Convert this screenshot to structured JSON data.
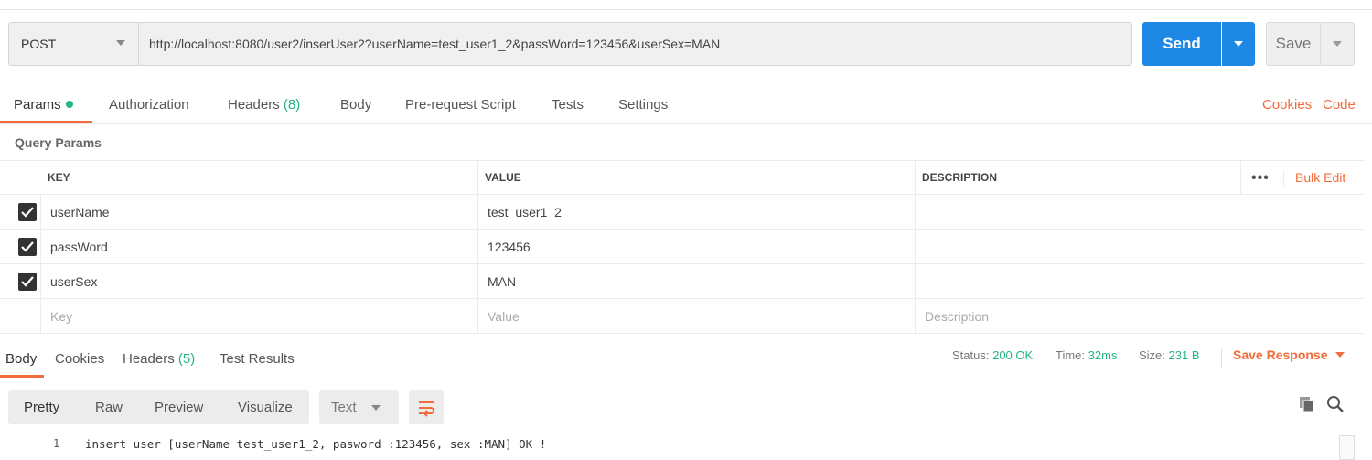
{
  "request": {
    "method": "POST",
    "url": "http://localhost:8080/user2/inserUser2?userName=test_user1_2&passWord=123456&userSex=MAN",
    "send_label": "Send",
    "save_label": "Save"
  },
  "request_tabs": {
    "params": "Params",
    "authorization": "Authorization",
    "headers": "Headers",
    "headers_count": "(8)",
    "body": "Body",
    "prerequest": "Pre-request Script",
    "tests": "Tests",
    "settings": "Settings",
    "cookies": "Cookies",
    "code": "Code"
  },
  "query_params": {
    "title": "Query Params",
    "columns": {
      "key": "KEY",
      "value": "VALUE",
      "description": "DESCRIPTION"
    },
    "more": "•••",
    "bulk_edit": "Bulk Edit",
    "rows": [
      {
        "key": "userName",
        "value": "test_user1_2",
        "checked": true
      },
      {
        "key": "passWord",
        "value": "123456",
        "checked": true
      },
      {
        "key": "userSex",
        "value": "MAN",
        "checked": true
      }
    ],
    "placeholders": {
      "key": "Key",
      "value": "Value",
      "description": "Description"
    }
  },
  "response_tabs": {
    "body": "Body",
    "cookies": "Cookies",
    "headers": "Headers",
    "headers_count": "(5)",
    "test_results": "Test Results"
  },
  "response_status": {
    "status_label": "Status:",
    "status_value": "200 OK",
    "time_label": "Time:",
    "time_value": "32ms",
    "size_label": "Size:",
    "size_value": "231 B",
    "save_response": "Save Response"
  },
  "response_view": {
    "formats": [
      "Pretty",
      "Raw",
      "Preview",
      "Visualize"
    ],
    "type": "Text",
    "line_number": "1",
    "line_text": "insert user [userName test_user1_2, pasword :123456, sex :MAN] OK !"
  },
  "colors": {
    "accent": "#f26b3a",
    "send": "#1e88e5",
    "success": "#26b47f"
  }
}
